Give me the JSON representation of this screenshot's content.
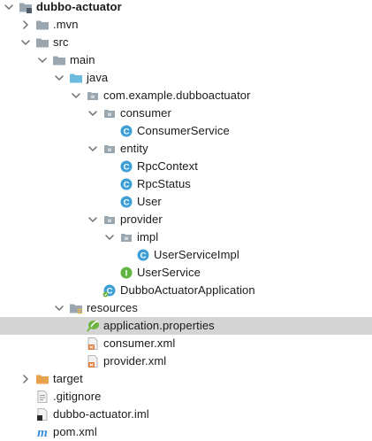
{
  "tree": {
    "rows": [
      {
        "label": "dubbo-actuator",
        "depth": 0,
        "arrow": "down",
        "icon": "module-folder",
        "bold": true
      },
      {
        "label": ".mvn",
        "depth": 1,
        "arrow": "right",
        "icon": "folder"
      },
      {
        "label": "src",
        "depth": 1,
        "arrow": "down",
        "icon": "folder"
      },
      {
        "label": "main",
        "depth": 2,
        "arrow": "down",
        "icon": "folder"
      },
      {
        "label": "java",
        "depth": 3,
        "arrow": "down",
        "icon": "source-folder"
      },
      {
        "label": "com.example.dubboactuator",
        "depth": 4,
        "arrow": "down",
        "icon": "package"
      },
      {
        "label": "consumer",
        "depth": 5,
        "arrow": "down",
        "icon": "package"
      },
      {
        "label": "ConsumerService",
        "depth": 6,
        "arrow": "none",
        "icon": "class"
      },
      {
        "label": "entity",
        "depth": 5,
        "arrow": "down",
        "icon": "package"
      },
      {
        "label": "RpcContext",
        "depth": 6,
        "arrow": "none",
        "icon": "class"
      },
      {
        "label": "RpcStatus",
        "depth": 6,
        "arrow": "none",
        "icon": "class"
      },
      {
        "label": "User",
        "depth": 6,
        "arrow": "none",
        "icon": "class"
      },
      {
        "label": "provider",
        "depth": 5,
        "arrow": "down",
        "icon": "package"
      },
      {
        "label": "impl",
        "depth": 6,
        "arrow": "down",
        "icon": "package"
      },
      {
        "label": "UserServiceImpl",
        "depth": 7,
        "arrow": "none",
        "icon": "class"
      },
      {
        "label": "UserService",
        "depth": 6,
        "arrow": "none",
        "icon": "interface"
      },
      {
        "label": "DubboActuatorApplication",
        "depth": 5,
        "arrow": "none",
        "icon": "spring-app-class"
      },
      {
        "label": "resources",
        "depth": 3,
        "arrow": "down",
        "icon": "resources-folder"
      },
      {
        "label": "application.properties",
        "depth": 4,
        "arrow": "none",
        "icon": "spring-properties",
        "selected": true
      },
      {
        "label": "consumer.xml",
        "depth": 4,
        "arrow": "none",
        "icon": "xml-file"
      },
      {
        "label": "provider.xml",
        "depth": 4,
        "arrow": "none",
        "icon": "xml-file"
      },
      {
        "label": "target",
        "depth": 1,
        "arrow": "right",
        "icon": "excluded-folder"
      },
      {
        "label": ".gitignore",
        "depth": 1,
        "arrow": "none",
        "icon": "text-file"
      },
      {
        "label": "dubbo-actuator.iml",
        "depth": 1,
        "arrow": "none",
        "icon": "iml-file"
      },
      {
        "label": "pom.xml",
        "depth": 1,
        "arrow": "none",
        "icon": "maven-file"
      }
    ]
  },
  "colors": {
    "folder": "#9aa7b0",
    "source_folder": "#6bbbe0",
    "resources_folder": "#9aa7b0",
    "excluded_folder": "#e8a24d",
    "class_badge": "#3d9fd6",
    "interface_badge": "#62b543",
    "spring_green": "#6db33f",
    "xml_orange": "#e07b39",
    "maven_blue": "#3b8cd9",
    "selection": "#d4d4d4",
    "arrow": "#6e6e6e",
    "text": "#1a1a1a"
  }
}
